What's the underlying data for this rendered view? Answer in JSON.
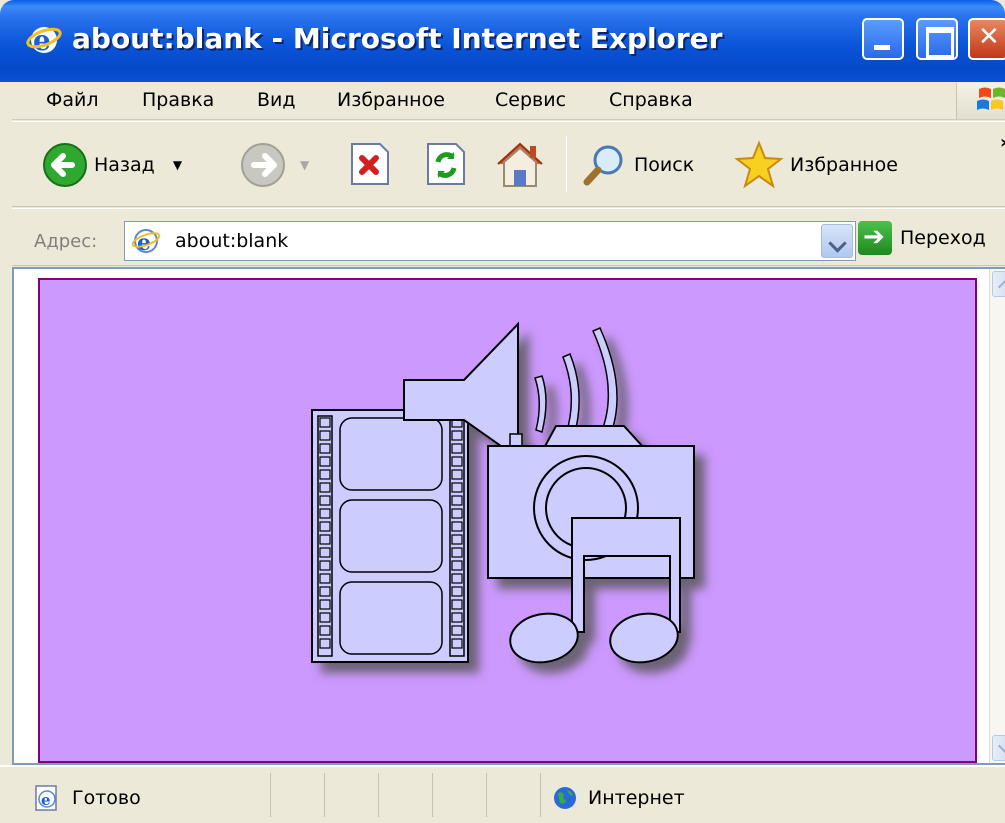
{
  "window": {
    "title": "about:blank - Microsoft Internet Explorer"
  },
  "menu": {
    "items": [
      {
        "label": "Файл"
      },
      {
        "label": "Правка"
      },
      {
        "label": "Вид"
      },
      {
        "label": "Избранное"
      },
      {
        "label": "Сервис"
      },
      {
        "label": "Справка"
      }
    ]
  },
  "toolbar": {
    "back_label": "Назад",
    "search_label": "Поиск",
    "favorites_label": "Избранное",
    "more_label": "»"
  },
  "address": {
    "label": "Адрес:",
    "value": "about:blank",
    "go_label": "Переход"
  },
  "page": {
    "background": "#cc99ff",
    "border": "#800080",
    "clipart": "multimedia-clipart (film strip, speaker, camera, music note)"
  },
  "status": {
    "text": "Готово",
    "zone": "Интернет"
  },
  "colors": {
    "titlebar": "#0a55d8",
    "chrome": "#ece9d8",
    "clipart_fill": "#ccccff"
  }
}
